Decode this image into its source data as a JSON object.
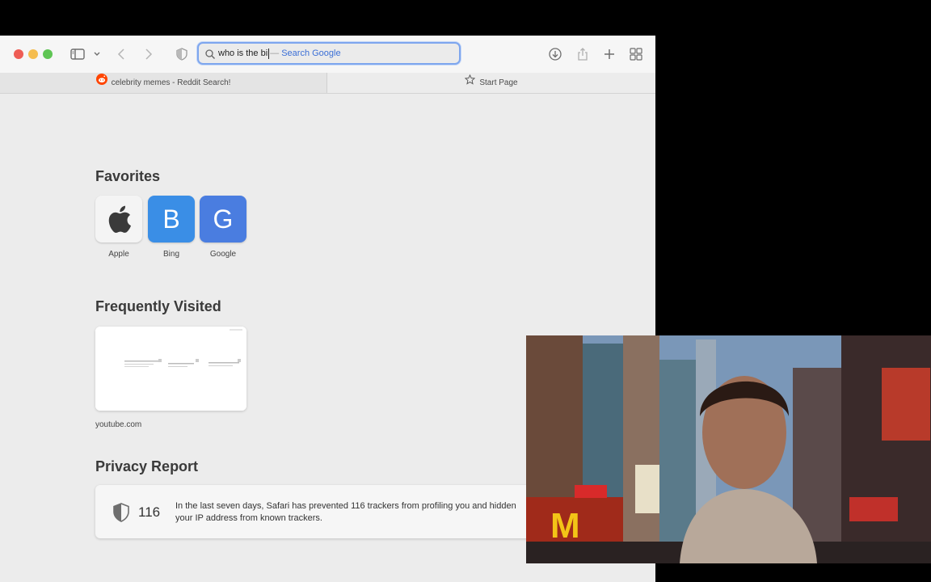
{
  "toolbar": {
    "address_typed": "who is the bi",
    "address_separator": "—",
    "address_suggestion": "Search Google"
  },
  "tabs": [
    {
      "title": "celebrity memes - Reddit Search!",
      "icon": "reddit-icon"
    },
    {
      "title": "Start Page",
      "icon": "star-icon"
    }
  ],
  "favorites": {
    "title": "Favorites",
    "items": [
      {
        "label": "Apple",
        "icon": "apple-logo"
      },
      {
        "label": "Bing",
        "letter": "B",
        "color": "#3a8ee6"
      },
      {
        "label": "Google",
        "letter": "G",
        "color": "#4a7de0"
      }
    ]
  },
  "frequently_visited": {
    "title": "Frequently Visited",
    "items": [
      {
        "label": "youtube.com"
      }
    ]
  },
  "privacy": {
    "title": "Privacy Report",
    "count": "116",
    "text": "In the last seven days, Safari has prevented 116 trackers from profiling you and hidden your IP address from known trackers."
  },
  "colors": {
    "accent": "#3b6fd6",
    "traffic_red": "#ee5d55",
    "traffic_yellow": "#f5bd4f",
    "traffic_green": "#5fc554"
  }
}
